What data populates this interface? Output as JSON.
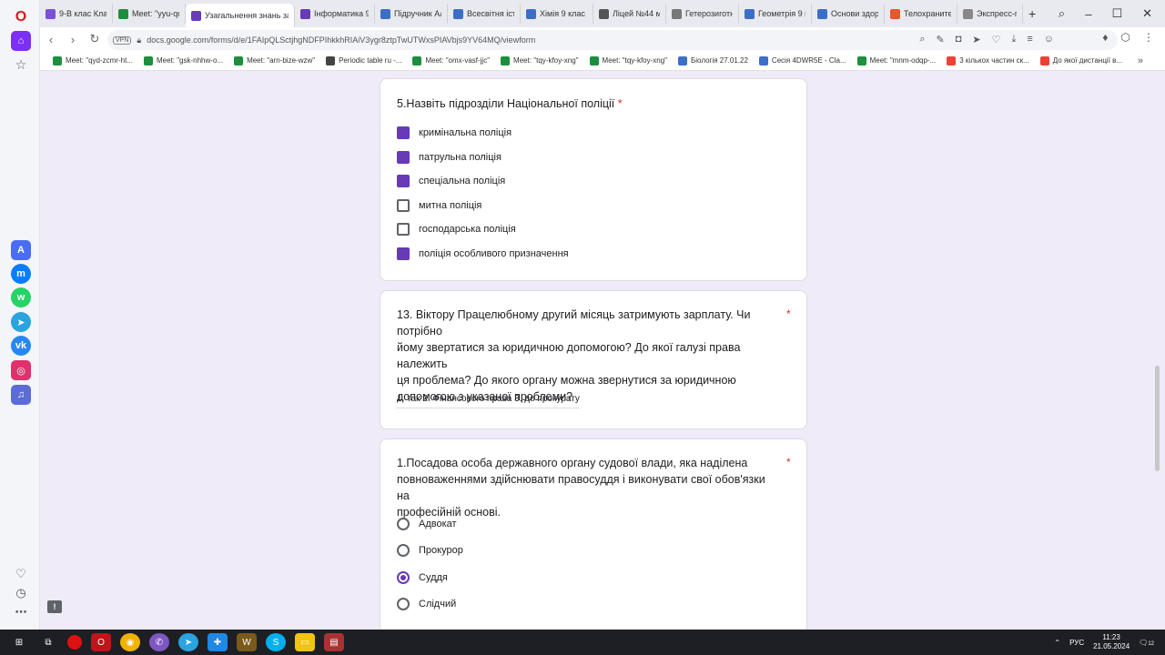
{
  "tabs": [
    {
      "label": "9-В клас Класна",
      "color": "#7b4fd6"
    },
    {
      "label": "Meet: \"yyu-qdaf",
      "color": "#1e8e3e"
    },
    {
      "label": "Узагальнення знань за р",
      "color": "#673ab7"
    },
    {
      "label": "Інформатика 9 к",
      "color": "#673ab7"
    },
    {
      "label": "Підручник Алге",
      "color": "#3b6fc7"
    },
    {
      "label": "Всесвітня істор",
      "color": "#3b6fc7"
    },
    {
      "label": "Хімія 9 клас - Ш",
      "color": "#3b6fc7"
    },
    {
      "label": "Ліцей №44 м. К",
      "color": "#555555"
    },
    {
      "label": "Гетерозиготніст",
      "color": "#777777"
    },
    {
      "label": "Геометрія 9 кла",
      "color": "#3b6fc7"
    },
    {
      "label": "Основи здоров",
      "color": "#3b6fc7"
    },
    {
      "label": "Телохранители",
      "color": "#e8572e"
    },
    {
      "label": "Экспресс-панель",
      "color": "#888888"
    }
  ],
  "url": {
    "vpn": "VPN",
    "text": "docs.google.com/forms/d/e/1FAIpQLSctjhgNDFPIhkkhRIAiV3ygr8ztpTwUTWxsPIAVbjs9YV64MQ/viewform"
  },
  "bookmarks": [
    {
      "label": "Meet: \"qyd-zcmr-ht...",
      "color": "#1e8e3e"
    },
    {
      "label": "Meet: \"gsk-nhhw-o...",
      "color": "#1e8e3e"
    },
    {
      "label": "Meet: \"arn-bize-wzw\"",
      "color": "#1e8e3e"
    },
    {
      "label": "Periodic table ru -...",
      "color": "#444444"
    },
    {
      "label": "Meet: \"omx-vasf-jjc\"",
      "color": "#1e8e3e"
    },
    {
      "label": "Meet: \"tqy-kfoy-xng\"",
      "color": "#1e8e3e"
    },
    {
      "label": "Meet: \"tqy-kfoy-xng\"",
      "color": "#1e8e3e"
    },
    {
      "label": "Біологія 27.01.22",
      "color": "#3b6fc7"
    },
    {
      "label": "Сесія 4DWR5E - Cla...",
      "color": "#3b6fc7"
    },
    {
      "label": "Meet: \"mnm-odqp-...",
      "color": "#1e8e3e"
    },
    {
      "label": "3 кількох частин ск...",
      "color": "#ea4335"
    },
    {
      "label": "До якої дистанції в...",
      "color": "#ea4335"
    }
  ],
  "q5": {
    "title": "5.Назвіть підрозділи Національної поліції",
    "required": "*",
    "options": [
      {
        "label": "кримінальна поліція",
        "checked": true
      },
      {
        "label": "патрульна поліція",
        "checked": true
      },
      {
        "label": "спеціальна поліція",
        "checked": true
      },
      {
        "label": "митна поліція",
        "checked": false
      },
      {
        "label": "господарська поліція",
        "checked": false
      },
      {
        "label": "поліція особливого призначення",
        "checked": true
      }
    ]
  },
  "q13": {
    "title_lines": [
      "13. Віктору Працелюбному другий місяць затримують зарплату. Чи потрібно",
      "йому звертатися за юридичною допомогою? До якої галузі права належить",
      "ця проблема? До якого органу можна звернутися за юридичною",
      "допомогою з указаної проблеми?"
    ],
    "required": "*",
    "answer": "1. так 2. Фінансового права 3. до прокурату"
  },
  "q1": {
    "title_lines": [
      "1.Посадова особа державного органу судової влади, яка наділена",
      "повноваженнями здійснювати правосуддя і виконувати свої обов'язки на",
      "професійній основі."
    ],
    "required": "*",
    "options": [
      {
        "label": "Адвокат",
        "selected": false
      },
      {
        "label": "Прокурор",
        "selected": false
      },
      {
        "label": "Суддя",
        "selected": true
      },
      {
        "label": "Слідчий",
        "selected": false
      }
    ]
  },
  "taskbar": {
    "lang": "РУС",
    "time": "11:23",
    "date": "21.05.2024",
    "notif": "12"
  }
}
